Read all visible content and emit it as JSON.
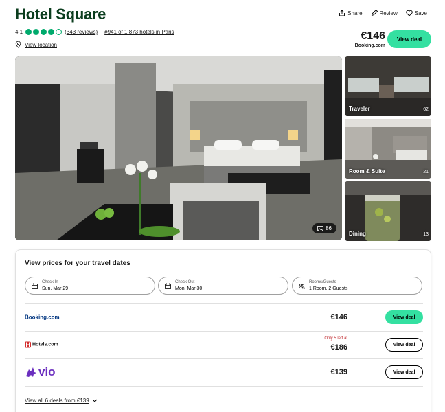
{
  "hotel": {
    "name": "Hotel Square",
    "rating": "4.1",
    "bubbles_filled": 4,
    "bubbles_total": 5,
    "reviews": "(343 reviews)",
    "rank": "#941 of 1,873 hotels in Paris",
    "location_link": "View location"
  },
  "actions": {
    "share": "Share",
    "review": "Review",
    "save": "Save"
  },
  "top_offer": {
    "price": "€146",
    "provider": "Booking.com",
    "button": "View deal"
  },
  "gallery": {
    "photo_count": "86",
    "thumbs": [
      {
        "label": "Traveler",
        "count": "62"
      },
      {
        "label": "Room & Suite",
        "count": "21"
      },
      {
        "label": "Dining",
        "count": "13"
      }
    ]
  },
  "prices": {
    "title": "View prices for your travel dates",
    "checkin": {
      "label": "Check In",
      "value": "Sun, Mar 29"
    },
    "checkout": {
      "label": "Check Out",
      "value": "Mon, Mar 30"
    },
    "guests": {
      "label": "Rooms/Guests",
      "value": "1 Room, 2 Guests"
    },
    "deals": [
      {
        "provider": "Booking.com",
        "price": "€146",
        "note": "",
        "button": "View deal"
      },
      {
        "provider": "Hotels.com",
        "price": "€186",
        "note": "Only 5 left at",
        "button": "View deal"
      },
      {
        "provider": "vio",
        "price": "€139",
        "note": "",
        "button": "View deal"
      }
    ],
    "view_all": "View all 6 deals from €139"
  },
  "colors": {
    "brand_green": "#34e0a1",
    "rating_green": "#00aa6c",
    "title_green": "#0b3d1e",
    "booking_blue": "#003580",
    "hotels_red": "#d32f2f",
    "vio_purple": "#6b2fbf"
  }
}
